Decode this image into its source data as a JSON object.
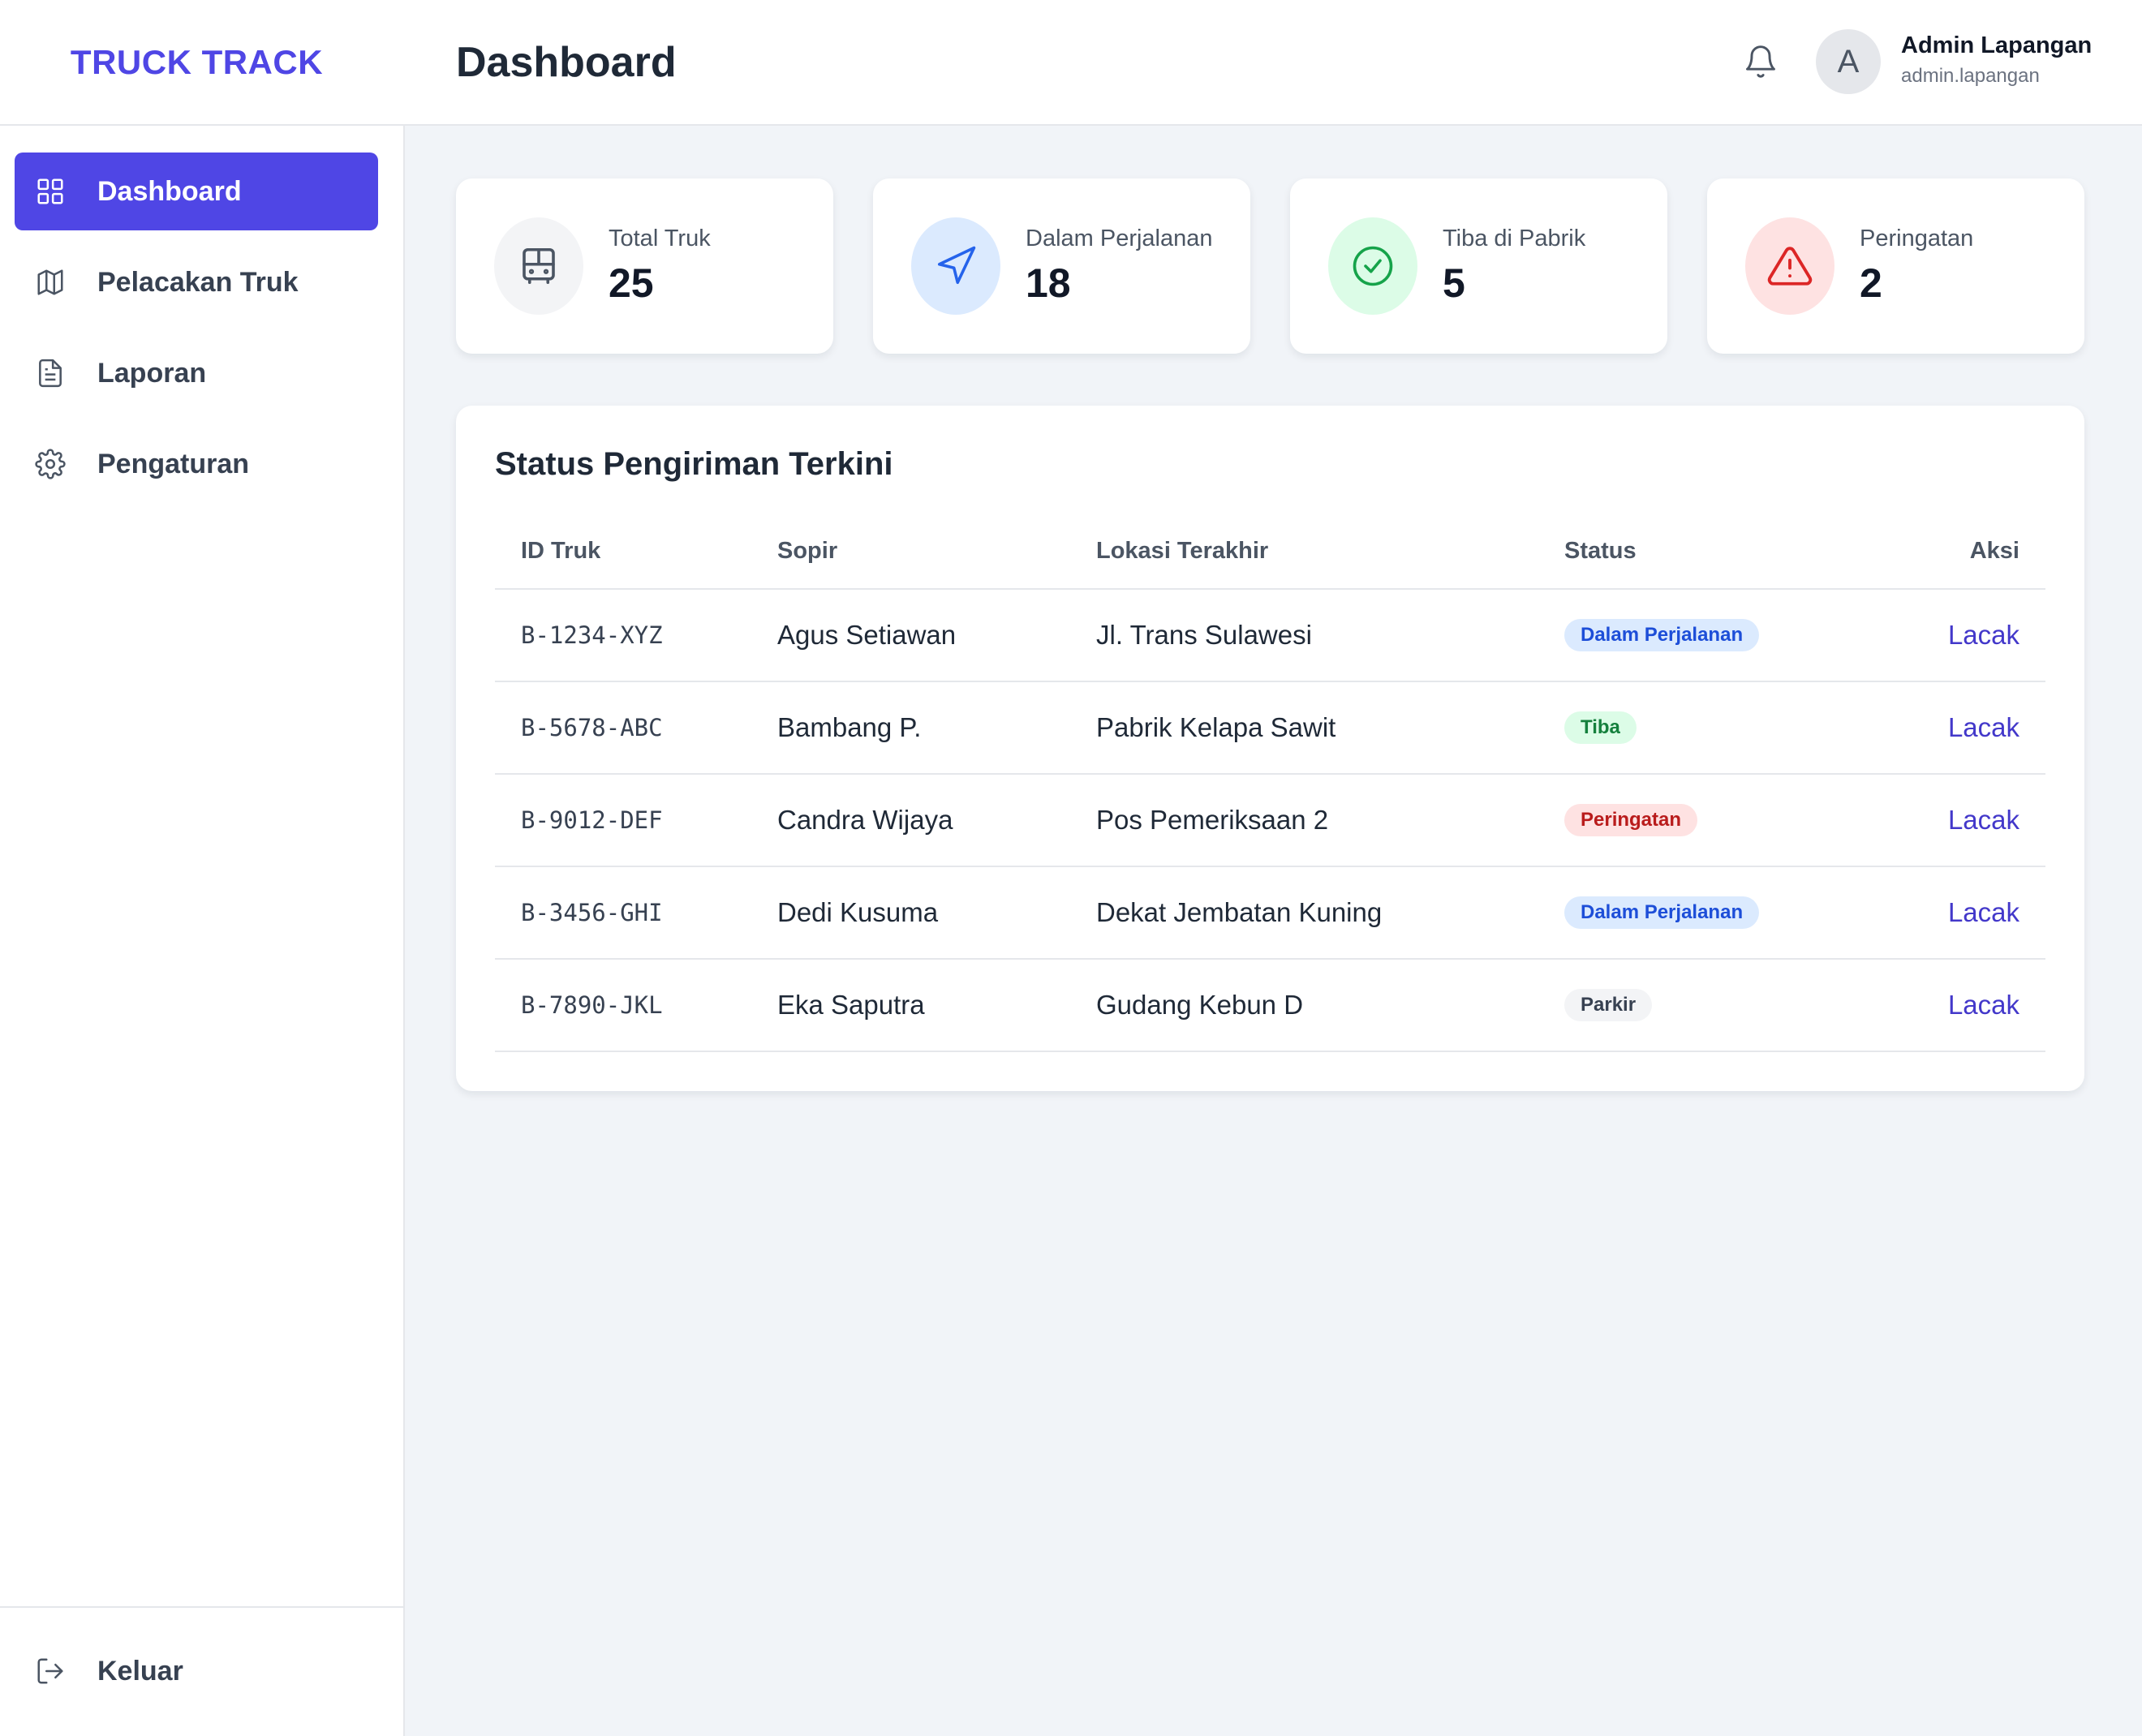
{
  "app": {
    "logo": "TRUCK TRACK",
    "page_title": "Dashboard"
  },
  "user": {
    "avatar_initial": "A",
    "name": "Admin Lapangan",
    "handle": "admin.lapangan"
  },
  "sidebar": {
    "items": [
      {
        "label": "Dashboard",
        "icon": "grid-icon",
        "active": true
      },
      {
        "label": "Pelacakan Truk",
        "icon": "map-icon",
        "active": false
      },
      {
        "label": "Laporan",
        "icon": "document-icon",
        "active": false
      },
      {
        "label": "Pengaturan",
        "icon": "gear-icon",
        "active": false
      }
    ],
    "logout_label": "Keluar"
  },
  "stats": [
    {
      "label": "Total Truk",
      "value": "25",
      "icon": "bus-icon",
      "bg": "#f3f4f6",
      "color": "#4b5563"
    },
    {
      "label": "Dalam Perjalanan",
      "value": "18",
      "icon": "navigation-icon",
      "bg": "#dbeafe",
      "color": "#2563eb"
    },
    {
      "label": "Tiba di Pabrik",
      "value": "5",
      "icon": "check-circle-icon",
      "bg": "#dcfce7",
      "color": "#16a34a"
    },
    {
      "label": "Peringatan",
      "value": "2",
      "icon": "alert-triangle-icon",
      "bg": "#fee2e2",
      "color": "#dc2626"
    }
  ],
  "table": {
    "title": "Status Pengiriman Terkini",
    "headers": {
      "id": "ID Truk",
      "driver": "Sopir",
      "location": "Lokasi Terakhir",
      "status": "Status",
      "action": "Aksi"
    },
    "rows": [
      {
        "id": "B-1234-XYZ",
        "driver": "Agus Setiawan",
        "location": "Jl. Trans Sulawesi",
        "status": "Dalam Perjalanan",
        "status_type": "transit",
        "action": "Lacak"
      },
      {
        "id": "B-5678-ABC",
        "driver": "Bambang P.",
        "location": "Pabrik Kelapa Sawit",
        "status": "Tiba",
        "status_type": "arrived",
        "action": "Lacak"
      },
      {
        "id": "B-9012-DEF",
        "driver": "Candra Wijaya",
        "location": "Pos Pemeriksaan 2",
        "status": "Peringatan",
        "status_type": "warning",
        "action": "Lacak"
      },
      {
        "id": "B-3456-GHI",
        "driver": "Dedi Kusuma",
        "location": "Dekat Jembatan Kuning",
        "status": "Dalam Perjalanan",
        "status_type": "transit",
        "action": "Lacak"
      },
      {
        "id": "B-7890-JKL",
        "driver": "Eka Saputra",
        "location": "Gudang Kebun D",
        "status": "Parkir",
        "status_type": "parked",
        "action": "Lacak"
      }
    ]
  },
  "colors": {
    "accent": "#4f46e5",
    "background": "#f1f4f8"
  }
}
